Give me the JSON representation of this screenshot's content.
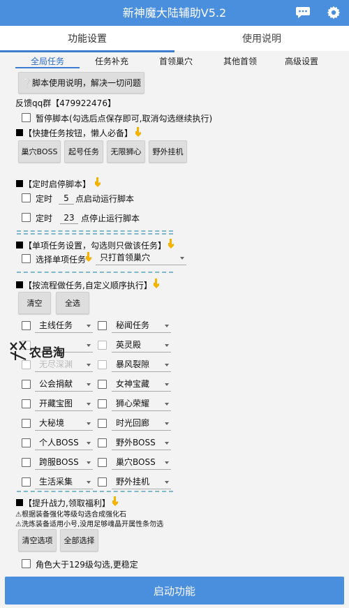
{
  "app": {
    "title": "新神魔大陆辅助V5.2",
    "brand_color": "#4a8ede"
  },
  "tabs": [
    "功能设置",
    "使用说明"
  ],
  "subtabs": [
    "全局任务",
    "任务补充",
    "首领巢穴",
    "其他首领",
    "高级设置"
  ],
  "help_button": "❔脚本使用说明，解决一切问题",
  "feedback": "反馈qq群【479922476】",
  "pause_label": "暂停脚本(勾选后点保存即可,取消勾选继续执行)",
  "quick_section": "【快捷任务按钮，懒人必备】",
  "quick_buttons": [
    "巢穴BOSS",
    "起号任务",
    "无限狮心",
    "野外挂机"
  ],
  "timer_section": "【定时启停脚本】",
  "timer": {
    "start_prefix": "定时",
    "start_hour": "5",
    "start_suffix": "点启动运行脚本",
    "stop_prefix": "定时",
    "stop_hour": "23",
    "stop_suffix": "点停止运行脚本"
  },
  "single_section": "【单项任务设置，勾选则只做该任务】",
  "single_label": "选择单项任务",
  "single_select": "只打首领巢穴",
  "flow_section": "【按流程做任务,自定义顺序执行】",
  "flow_buttons": [
    "清空",
    "全选"
  ],
  "flow_rows": [
    [
      "主线任务",
      "秘闻任务"
    ],
    [
      "",
      "英灵殿"
    ],
    [
      "无尽深渊",
      "暴风裂隙"
    ],
    [
      "公会捐献",
      "女神宝藏"
    ],
    [
      "开藏宝图",
      "狮心荣耀"
    ],
    [
      "大秘境",
      "时光回廊"
    ],
    [
      "个人BOSS",
      "野外BOSS"
    ],
    [
      "跨服BOSS",
      "巢穴BOSS"
    ],
    [
      "生活采集",
      "野外挂机"
    ]
  ],
  "boost_section": "【提升战力,领取福利】",
  "boost_note1": "⚠根据装备强化等级勾选合成强化石",
  "boost_note2": "⚠洗炼装备适用小号,没用足够魂晶开属性条勿选",
  "boost_buttons": [
    "清空选项",
    "全部选择"
  ],
  "level_label": "角色大于129级勾选,更稳定",
  "start_button": "启动功能",
  "watermark": {
    "text": "农邑淘"
  }
}
